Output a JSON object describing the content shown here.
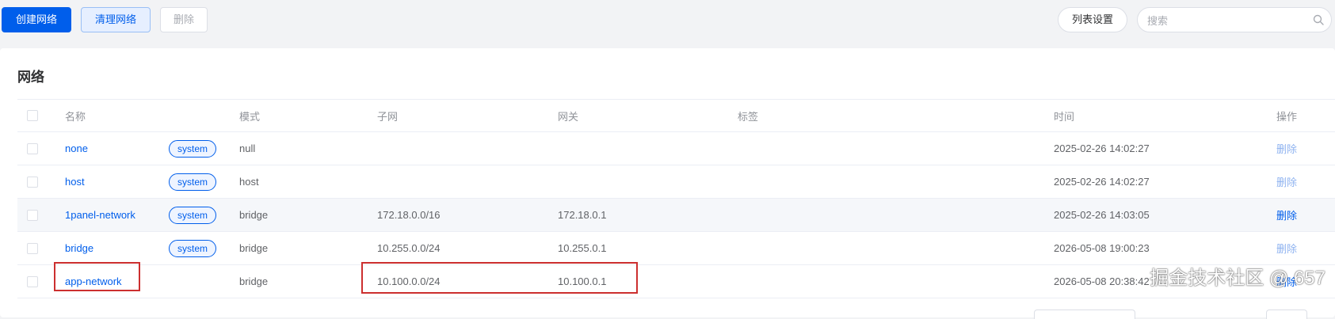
{
  "toolbar": {
    "create_label": "创建网络",
    "prune_label": "清理网络",
    "delete_label": "删除",
    "column_settings_label": "列表设置",
    "search_placeholder": "搜索"
  },
  "card": {
    "title": "网络"
  },
  "table": {
    "headers": {
      "name": "名称",
      "mode": "模式",
      "subnet": "子网",
      "gateway": "网关",
      "labels": "标签",
      "time": "时间",
      "ops": "操作"
    },
    "rows": [
      {
        "name": "none",
        "badge": "system",
        "mode": "null",
        "subnet": "",
        "gateway": "",
        "time": "2025-02-26 14:02:27",
        "op": "删除",
        "op_enabled": false
      },
      {
        "name": "host",
        "badge": "system",
        "mode": "host",
        "subnet": "",
        "gateway": "",
        "time": "2025-02-26 14:02:27",
        "op": "删除",
        "op_enabled": false
      },
      {
        "name": "1panel-network",
        "badge": "system",
        "mode": "bridge",
        "subnet": "172.18.0.0/16",
        "gateway": "172.18.0.1",
        "time": "2025-02-26 14:03:05",
        "op": "删除",
        "op_enabled": true
      },
      {
        "name": "bridge",
        "badge": "system",
        "mode": "bridge",
        "subnet": "10.255.0.0/24",
        "gateway": "10.255.0.1",
        "time": "2026-05-08 19:00:23",
        "op": "删除",
        "op_enabled": false
      },
      {
        "name": "app-network",
        "badge": "",
        "mode": "bridge",
        "subnet": "10.100.0.0/24",
        "gateway": "10.100.0.1",
        "time": "2026-05-08 20:38:42",
        "op": "删除",
        "op_enabled": true
      }
    ]
  },
  "watermark": "掘金技术社区 @ 657",
  "colors": {
    "primary": "#005eeb",
    "highlight_border": "#cc2f2f",
    "disabled_link": "#8fb3f0"
  }
}
